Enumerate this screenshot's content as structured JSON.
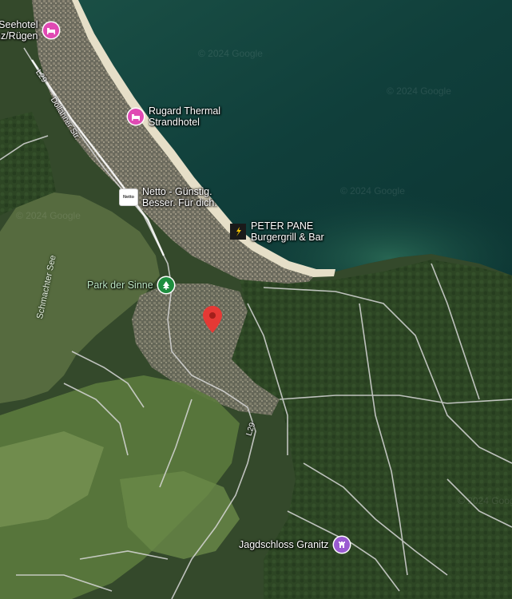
{
  "map": {
    "view": "satellite",
    "watermark_text": "© 2024 Google",
    "colors": {
      "sea_deep": "#0f3b37",
      "sea_shallow": "#1d5a4f",
      "beach": "#e9e3cf",
      "lake": "#556b3e",
      "forest": "#2f4a26",
      "field": "#5a7a3c",
      "town": "#8a8577",
      "road": "#d9d9d9",
      "hotel_pin": "#e04ab3",
      "park_pin": "#1e8e3e",
      "castle_pin": "#9a5bd1",
      "marker": "#e53935"
    }
  },
  "pois": [
    {
      "id": "seehotel",
      "label": "Seehotel\nnz/Rügen",
      "icon": "hotel-bed-icon"
    },
    {
      "id": "rugard",
      "label": "Rugard Thermal\nStrandhotel",
      "icon": "hotel-bed-icon"
    },
    {
      "id": "netto",
      "label": "Netto - Günstig.\nBesser. Für dich.",
      "icon": "netto-logo-icon",
      "logo_text": "Netto"
    },
    {
      "id": "peter-pane",
      "label": "PETER PANE\nBurgergrill & Bar",
      "icon": "restaurant-icon"
    },
    {
      "id": "park-der-sinne",
      "label": "Park der Sinne",
      "icon": "tree-icon"
    },
    {
      "id": "jagdschloss",
      "label": "Jagdschloss Granitz",
      "icon": "castle-icon"
    }
  ],
  "roads": [
    {
      "id": "l29-north",
      "label": "L29"
    },
    {
      "id": "dollahner",
      "label": "Dollahner Str."
    },
    {
      "id": "l29-south",
      "label": "L29"
    }
  ],
  "water": [
    {
      "id": "schmachter-see",
      "label": "Schmachter See"
    }
  ]
}
